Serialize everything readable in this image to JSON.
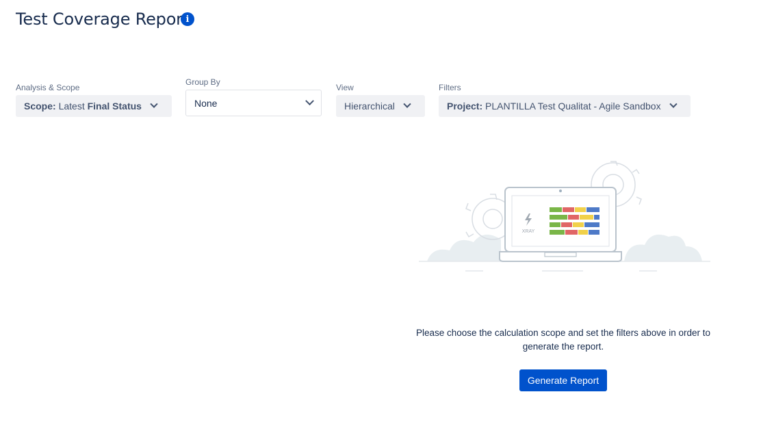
{
  "header": {
    "title": "Test Coverage Report",
    "info_glyph": "i"
  },
  "filters": {
    "analysis_scope": {
      "label": "Analysis & Scope",
      "prefix": "Scope:",
      "value_plain": "Latest",
      "value_bold": "Final Status"
    },
    "group_by": {
      "label": "Group By",
      "value": "None"
    },
    "view": {
      "label": "View",
      "value": "Hierarchical"
    },
    "filters": {
      "label": "Filters",
      "prefix": "Project:",
      "value": "PLANTILLA Test Qualitat - Agile Sandbox"
    }
  },
  "illustration": {
    "logo_text": "XRAY",
    "icon": "xray-lightning-icon"
  },
  "empty_state": {
    "message": "Please choose the calculation scope and set the filters above in order to generate the report.",
    "button_label": "Generate Report"
  },
  "colors": {
    "primary": "#0052cc",
    "pill_bg": "#f0f1f4",
    "text": "#172b4d"
  }
}
